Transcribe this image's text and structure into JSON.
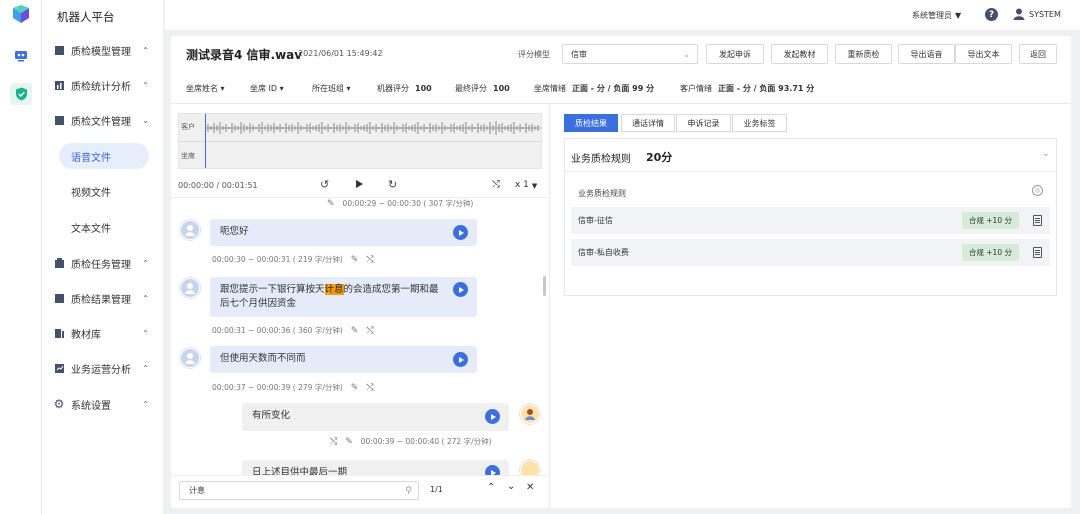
{
  "app": {
    "title": "机器人平台",
    "user_role": "系统管理员",
    "user_name": "SYSTEM"
  },
  "nav": [
    {
      "label": "质检模型管理",
      "chev": "⌃"
    },
    {
      "label": "质检统计分析",
      "chev": "⌃"
    },
    {
      "label": "质检文件管理",
      "chev": "⌄"
    },
    {
      "label": "质检任务管理",
      "chev": "⌃"
    },
    {
      "label": "质检结果管理",
      "chev": "⌃"
    },
    {
      "label": "教材库",
      "chev": "⌃"
    },
    {
      "label": "业务运营分析",
      "chev": "⌃"
    },
    {
      "label": "系统设置",
      "chev": "⌃"
    }
  ],
  "subnav": [
    "语音文件",
    "视频文件",
    "文本文件"
  ],
  "file": {
    "name": "测试录音4 信审.wav",
    "datetime": "2021/06/01 15:49:42"
  },
  "model": {
    "label": "评分模型",
    "value": "信审"
  },
  "buttons": [
    "发起申诉",
    "发起教材",
    "重新质检",
    "导出语音",
    "导出文本",
    "返回"
  ],
  "meta": {
    "agent_name": "坐席姓名",
    "agent_id": "坐席 ID",
    "group": "所在班组",
    "robot_score_label": "机器评分",
    "robot_score": "100",
    "final_score_label": "最终评分",
    "final_score": "100",
    "agent_emotion_label": "坐席情绪",
    "agent_emotion": "正面 - 分 / 负面 99 分",
    "customer_emotion_label": "客户情绪",
    "customer_emotion": "正面 - 分 / 负面 93.71 分"
  },
  "wave": {
    "customer": "客户",
    "agent": "坐席"
  },
  "player": {
    "time": "00:00:00 / 00:01:51",
    "speed": "x 1"
  },
  "chat": {
    "top_time": "00:00:29 ~ 00:00:30 ( 307 字/分钟)",
    "msgs": [
      {
        "text": "呃您好",
        "time": "00:00:30 ~ 00:00:31 ( 219 字/分钟)"
      },
      {
        "pre": "跟您提示一下银行算按天",
        "hl": "计息",
        "post": "的会造成您第一期和最后七个月供因资金",
        "time": "00:00:31 ~ 00:00:36 ( 360 字/分钟)"
      },
      {
        "text": "但使用天数而不同而",
        "time": "00:00:37 ~ 00:00:39 ( 279 字/分钟)"
      },
      {
        "text": "有所变化",
        "time": "00:00:39 ~ 00:00:40 ( 272 字/分钟)"
      },
      {
        "text": "日上述目供中最后一期"
      }
    ]
  },
  "search": {
    "value": "计息",
    "count": "1/1"
  },
  "tabs": [
    "质检结果",
    "通话详情",
    "申诉记录",
    "业务标签"
  ],
  "result": {
    "section_title": "业务质检规则",
    "score": "20分",
    "rules_header": "业务质检规则",
    "rules": [
      {
        "name": "信审-征信",
        "badge": "合规 +10 分"
      },
      {
        "name": "信审-私自收费",
        "badge": "合规 +10 分"
      }
    ]
  },
  "colors": {
    "accent": "#3b6fde",
    "bubble": "#e6ebf9",
    "highlight": "#f39c12",
    "badge": "#d6ecd8"
  }
}
